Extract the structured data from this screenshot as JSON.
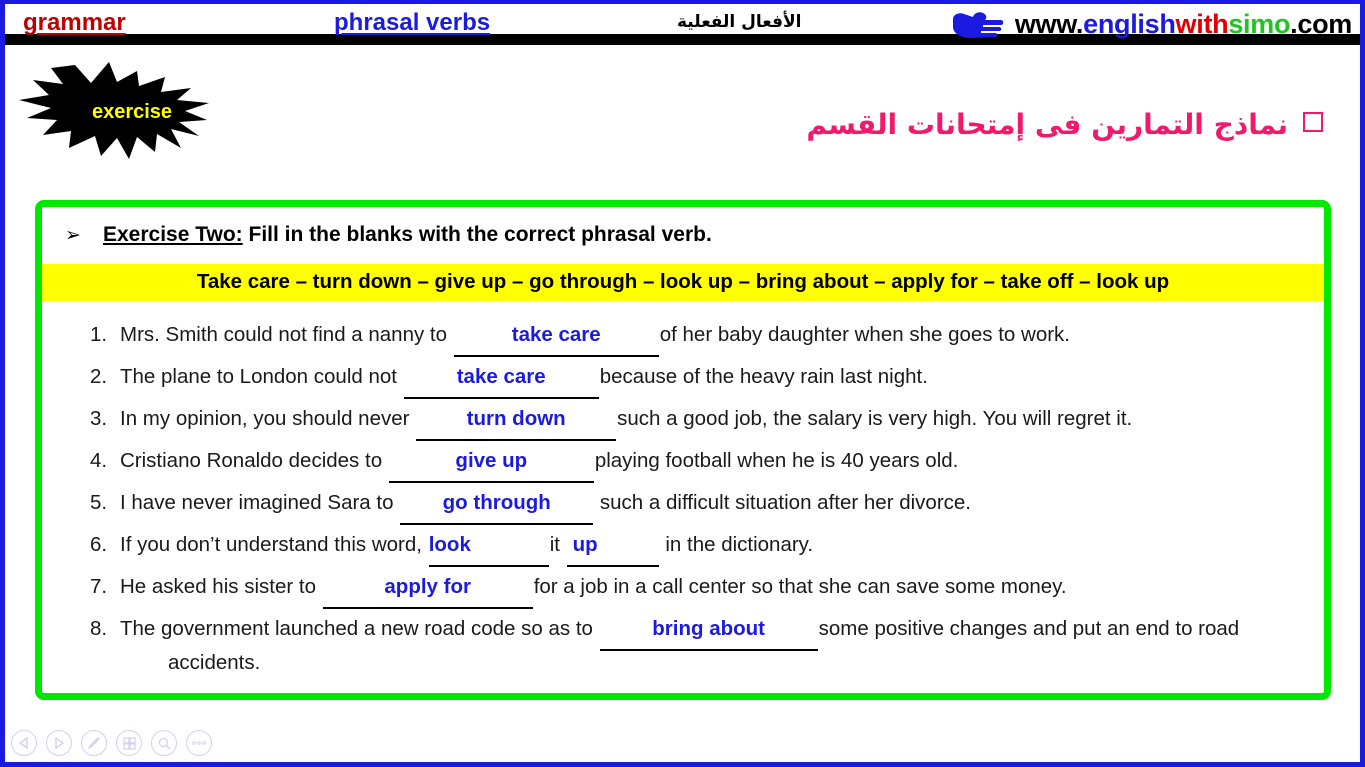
{
  "header": {
    "grammar_label": "grammar",
    "topic_label": "phrasal verbs",
    "arabic_topic": "الأفعال الفعلية",
    "logo": {
      "www": "www.",
      "english": "english",
      "with": "with",
      "simo": "simo",
      "com": ".com"
    },
    "colors": {
      "grammar": "#c00000",
      "topic": "#1a1ae0",
      "english": "#1a1ae0",
      "with": "#e00000",
      "simo": "#22c322",
      "page_border": "#1a1ae0"
    }
  },
  "badge": {
    "label": "exercise",
    "fill": "#000000",
    "text_color": "#ffff00"
  },
  "subtitle": {
    "arabic": "نماذج التمارين فى إمتحانات القسم",
    "color": "#f0196b"
  },
  "exercise": {
    "frame_color": "#00e800",
    "bullet": "➢",
    "title": "Exercise Two:",
    "instruction": "Fill in the blanks with the correct phrasal verb.",
    "wordbank": "Take care – turn down – give up – go through – look up – bring about – apply for – take off – look up",
    "wordbank_bg": "#ffff00",
    "answer_color": "#1a1ae0",
    "questions": [
      {
        "num": "1.",
        "before": "Mrs. Smith could not find a nanny to",
        "answer": "take care",
        "after": "of her baby daughter when she goes to work."
      },
      {
        "num": "2.",
        "before": "The plane to London could not",
        "answer": "take care",
        "after": "because of the heavy rain last night."
      },
      {
        "num": "3.",
        "before": "In my opinion, you should never",
        "answer": "turn down",
        "after": "such a good job, the salary is very high. You will regret it."
      },
      {
        "num": "4.",
        "before": "Cristiano Ronaldo decides to",
        "answer": "give up",
        "after": "playing football when he is 40 years old."
      },
      {
        "num": "5.",
        "before": "I have never imagined Sara to",
        "answer": "go through",
        "after": " such a difficult situation after her divorce."
      },
      {
        "num": "6.",
        "before": "If you don’t understand this word,",
        "answer": "look",
        "middle": "it",
        "answer2": "up",
        "after": " in the dictionary."
      },
      {
        "num": "7.",
        "before": "He asked his sister to",
        "answer": "apply for",
        "after": "for a job in a call center so that she can save some money."
      },
      {
        "num": "8.",
        "before": "The government launched a new road code so as to",
        "answer": "bring about",
        "after": "some positive changes and put an end to road",
        "continuation": "accidents."
      }
    ]
  },
  "toolbar": {
    "items": [
      {
        "name": "previous-slide"
      },
      {
        "name": "next-slide"
      },
      {
        "name": "pen-tool"
      },
      {
        "name": "slide-grid"
      },
      {
        "name": "zoom-tool"
      },
      {
        "name": "more-options"
      }
    ]
  }
}
